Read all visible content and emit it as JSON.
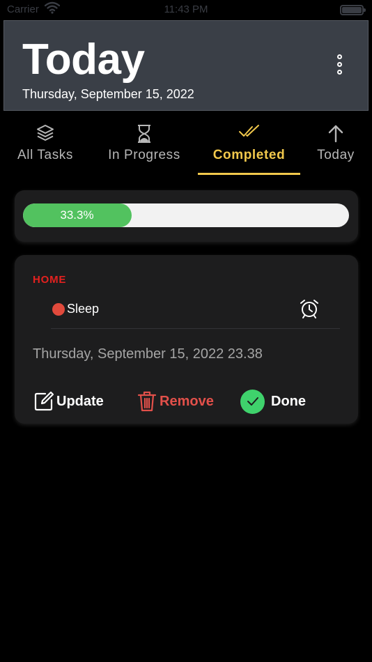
{
  "status_bar": {
    "carrier": "Carrier",
    "time": "11:43 PM",
    "icons": [
      "wifi-icon",
      "battery-icon"
    ]
  },
  "header": {
    "title": "Today",
    "date": "Thursday, September 15, 2022",
    "menu_icon": "more-vertical-icon",
    "background": "#3a3f47"
  },
  "tabs": [
    {
      "label": "All Tasks",
      "icon": "layers-icon",
      "active": false
    },
    {
      "label": "In Progress",
      "icon": "hourglass-icon",
      "active": false
    },
    {
      "label": "Completed",
      "icon": "double-check-icon",
      "active": true
    },
    {
      "label": "Today",
      "icon": "arrow-up-icon",
      "active": false
    }
  ],
  "progress": {
    "text": "33.3%",
    "fraction": 0.333,
    "color": "#52c25f"
  },
  "task": {
    "category": "HOME",
    "category_color": "#e4211f",
    "priority_color": "#e14a3c",
    "name": "Sleep",
    "datetime": "Thursday, September 15, 2022 23.38",
    "alarm_icon": "alarm-clock-icon",
    "actions": {
      "update_label": "Update",
      "remove_label": "Remove",
      "done_label": "Done"
    }
  },
  "colors": {
    "accent": "#f1c84c",
    "done": "#3fd26c",
    "remove": "#e2504a"
  }
}
